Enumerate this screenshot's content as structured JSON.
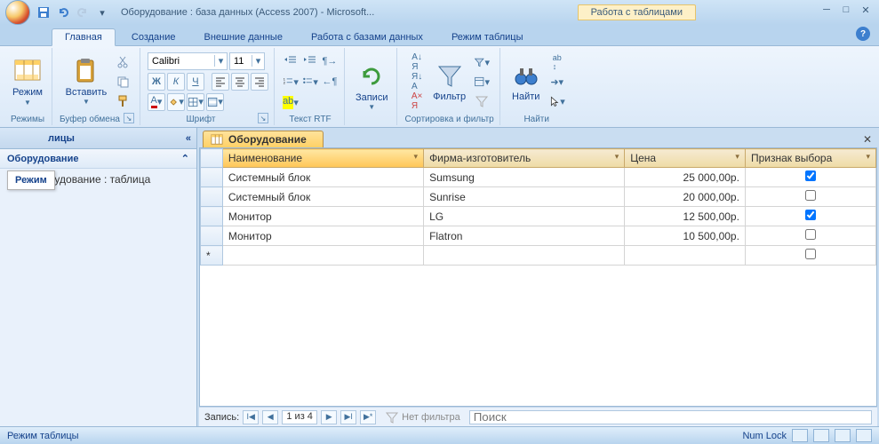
{
  "title": "Оборудование : база данных (Access 2007) - Microsoft...",
  "contextualTab": "Работа с таблицами",
  "tabs": {
    "home": "Главная",
    "create": "Создание",
    "external": "Внешние данные",
    "dbtools": "Работа с базами данных",
    "datasheet": "Режим таблицы"
  },
  "groups": {
    "views": "Режимы",
    "clipboard": "Буфер обмена",
    "font": "Шрифт",
    "richtext": "Текст RTF",
    "records": "Записи",
    "sortfilter": "Сортировка и фильтр",
    "find": "Найти"
  },
  "buttons": {
    "view": "Режим",
    "paste": "Вставить",
    "records": "Записи",
    "filter": "Фильтр",
    "find": "Найти"
  },
  "font": {
    "name": "Calibri",
    "size": "11"
  },
  "nav": {
    "headerTooltip": "Режим",
    "headerSuffix": "лицы",
    "category": "Оборудование",
    "item": "Оборудование : таблица"
  },
  "docTab": "Оборудование",
  "columns": {
    "name": "Наименование",
    "manufacturer": "Фирма-изготовитель",
    "price": "Цена",
    "flag": "Признак выбора"
  },
  "rows": [
    {
      "name": "Системный блок",
      "manufacturer": "Sumsung",
      "price": "25 000,00р.",
      "flag": true
    },
    {
      "name": "Системный блок",
      "manufacturer": "Sunrise",
      "price": "20 000,00р.",
      "flag": false
    },
    {
      "name": "Монитор",
      "manufacturer": "LG",
      "price": "12 500,00р.",
      "flag": true
    },
    {
      "name": "Монитор",
      "manufacturer": "Flatron",
      "price": "10 500,00р.",
      "flag": false
    }
  ],
  "recordnav": {
    "label": "Запись:",
    "pos": "1 из 4",
    "nofilter": "Нет фильтра",
    "searchPlaceholder": "Поиск"
  },
  "status": {
    "left": "Режим таблицы",
    "numlock": "Num Lock"
  }
}
